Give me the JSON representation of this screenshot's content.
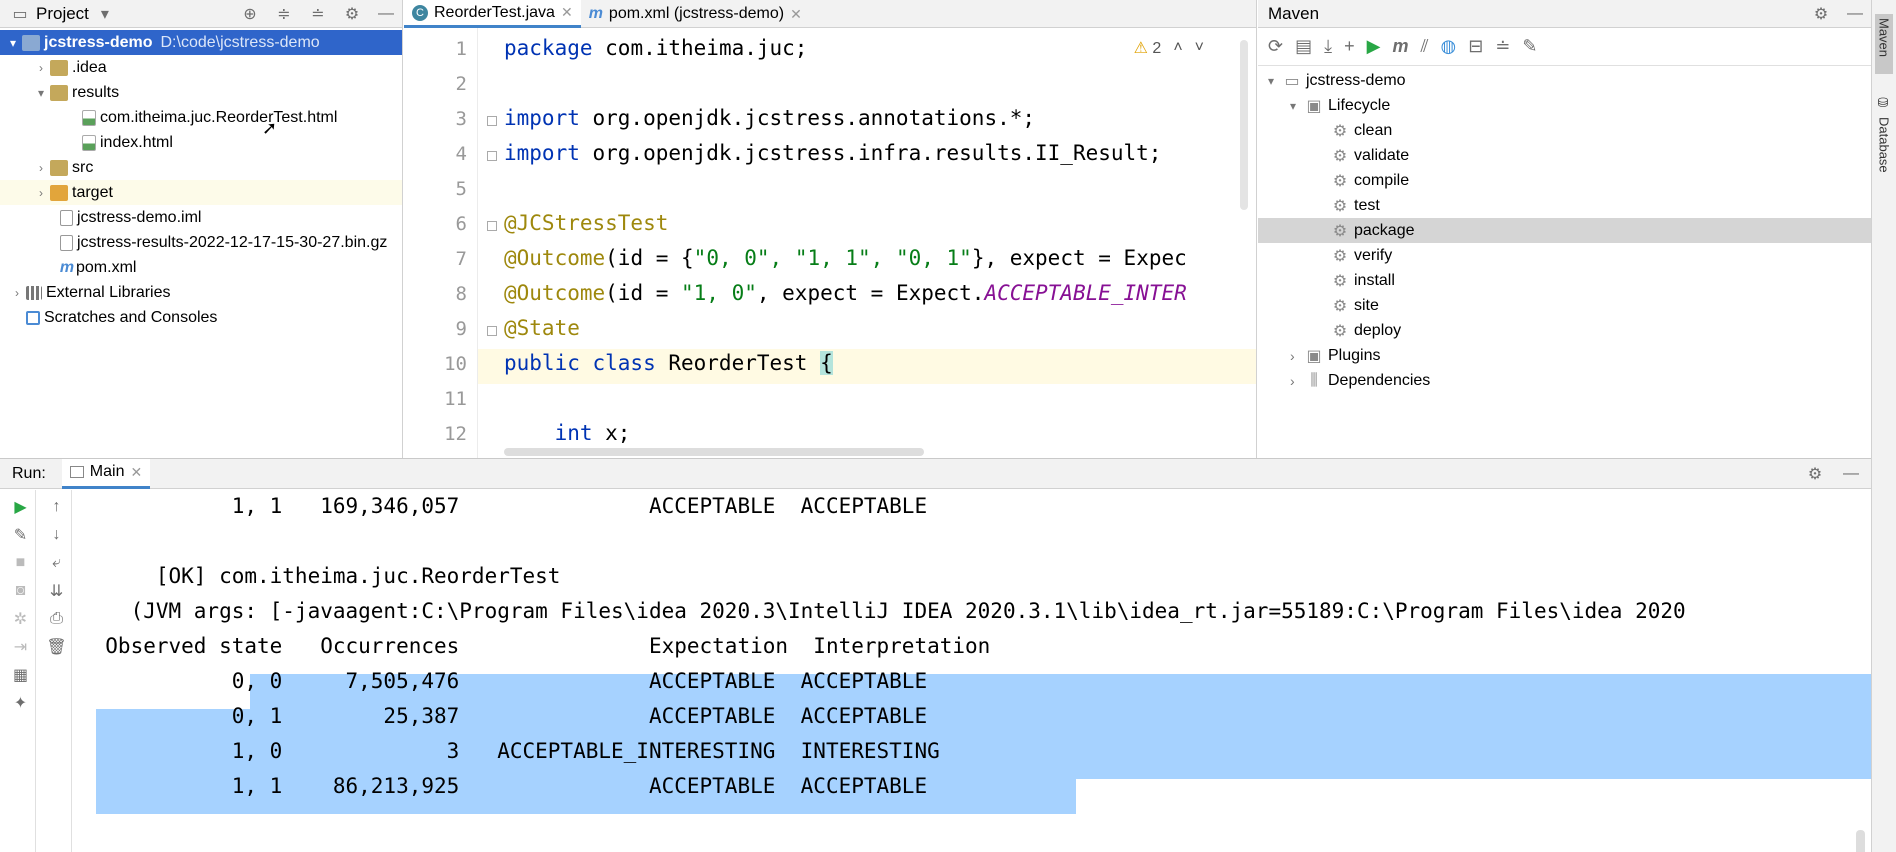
{
  "project": {
    "header_title": "Project",
    "tree": [
      {
        "label": "jcstress-demo",
        "path": "D:\\code\\jcstress-demo"
      },
      {
        "label": ".idea"
      },
      {
        "label": "results"
      },
      {
        "label": "com.itheima.juc.ReorderTest.html"
      },
      {
        "label": "index.html"
      },
      {
        "label": "src"
      },
      {
        "label": "target"
      },
      {
        "label": "jcstress-demo.iml"
      },
      {
        "label": "jcstress-results-2022-12-17-15-30-27.bin.gz"
      },
      {
        "label": "pom.xml"
      },
      {
        "label": "External Libraries"
      },
      {
        "label": "Scratches and Consoles"
      }
    ]
  },
  "editor": {
    "tabs": [
      {
        "label": "ReorderTest.java",
        "icon": "c"
      },
      {
        "label": "pom.xml (jcstress-demo)",
        "icon": "m"
      }
    ],
    "warning_count": "2",
    "line_numbers": [
      "1",
      "2",
      "3",
      "4",
      "5",
      "6",
      "7",
      "8",
      "9",
      "10",
      "11",
      "12"
    ],
    "lines": {
      "l1_kw": "package",
      "l1_rest": " com.itheima.juc;",
      "l3_kw": "import",
      "l3_rest": " org.openjdk.jcstress.annotations.*;",
      "l4_kw": "import",
      "l4_rest": " org.openjdk.jcstress.infra.results.II_Result;",
      "l6": "@JCStressTest",
      "l7_ann": "@Outcome",
      "l7_a": "(id = {",
      "l7_s": "\"0, 0\", \"1, 1\", \"0, 1\"",
      "l7_b": "}, expect = Expec",
      "l8_ann": "@Outcome",
      "l8_a": "(id = ",
      "l8_s": "\"1, 0\"",
      "l8_b": ", expect = Expect.",
      "l8_c": "ACCEPTABLE_INTER",
      "l9": "@State",
      "l10_kw": "public class",
      "l10_rest": " ReorderTest ",
      "l10_brace": "{",
      "l12_kw": "int",
      "l12_rest": " x;"
    }
  },
  "maven": {
    "header_title": "Maven",
    "project": "jcstress-demo",
    "lifecycle": "Lifecycle",
    "goals": [
      "clean",
      "validate",
      "compile",
      "test",
      "package",
      "verify",
      "install",
      "site",
      "deploy"
    ],
    "plugins": "Plugins",
    "dependencies": "Dependencies"
  },
  "right_strip": {
    "maven": "Maven",
    "database": "Database"
  },
  "run": {
    "label": "Run:",
    "tab": "Main",
    "console": [
      "            1, 1   169,346,057               ACCEPTABLE  ACCEPTABLE",
      "",
      "      [OK] com.itheima.juc.ReorderTest",
      "    (JVM args: [-javaagent:C:\\Program Files\\idea 2020.3\\IntelliJ IDEA 2020.3.1\\lib\\idea_rt.jar=55189:C:\\Program Files\\idea 2020",
      "  Observed state   Occurrences               Expectation  Interpretation",
      "            0, 0     7,505,476               ACCEPTABLE  ACCEPTABLE",
      "            0, 1        25,387               ACCEPTABLE  ACCEPTABLE",
      "            1, 0             3   ACCEPTABLE_INTERESTING  INTERESTING",
      "            1, 1    86,213,925               ACCEPTABLE  ACCEPTABLE"
    ]
  },
  "colors": {
    "selection": "#2f65ca",
    "console_highlight": "#a6d2ff"
  }
}
